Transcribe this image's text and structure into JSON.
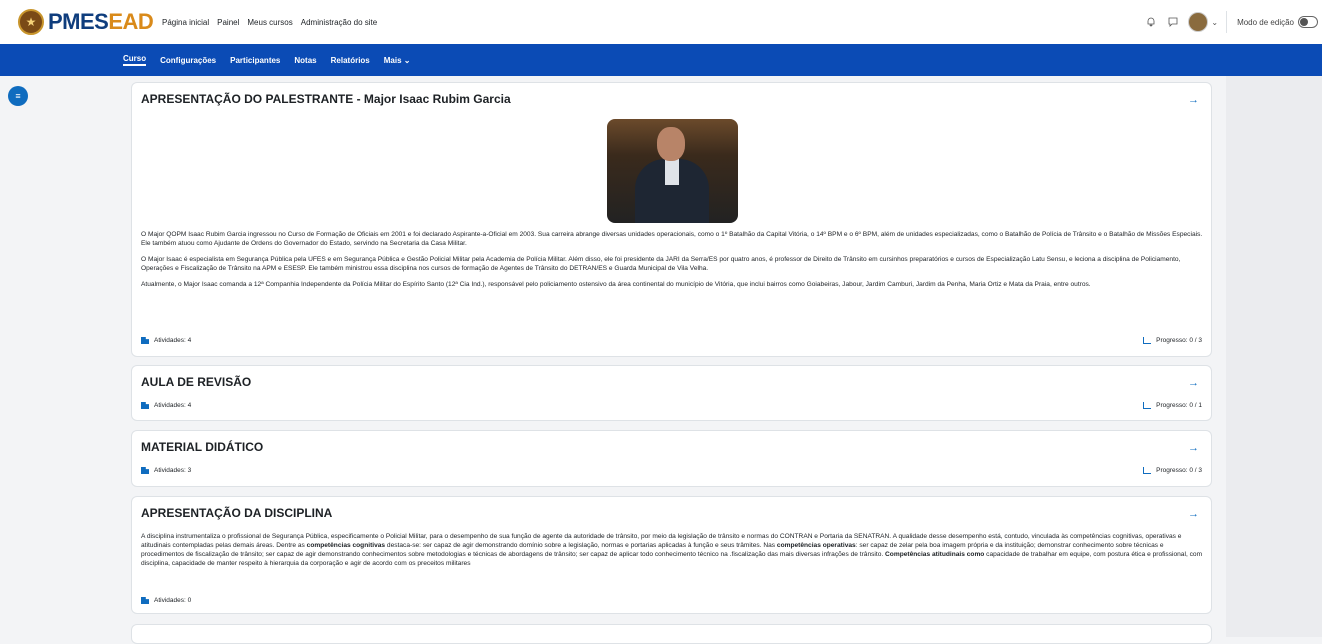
{
  "brand": {
    "logo_text_a": "PMES",
    "logo_text_b": "EAD"
  },
  "primary_nav": [
    "Página inicial",
    "Painel",
    "Meus cursos",
    "Administração do site"
  ],
  "user_menu": {
    "edit_mode_label": "Modo de edição"
  },
  "course_nav": {
    "items": [
      "Curso",
      "Configurações",
      "Participantes",
      "Notas",
      "Relatórios",
      "Mais ⌄"
    ],
    "active": "Curso"
  },
  "sections": [
    {
      "title": "APRESENTAÇÃO DO PALESTRANTE - Major Isaac Rubim Garcia",
      "paragraphs": [
        "O Major QOPM Isaac Rubim Garcia ingressou no Curso de Formação de Oficiais em 2001 e foi declarado Aspirante-a-Oficial em 2003. Sua carreira abrange diversas unidades operacionais, como o 1º Batalhão da Capital Vitória, o 14º BPM e o 6º BPM, além de unidades especializadas, como o Batalhão de Polícia de Trânsito e o Batalhão de Missões Especiais. Ele também atuou como Ajudante de Ordens do Governador do Estado, servindo na Secretaria da Casa Militar.",
        "O Major Isaac é especialista em Segurança Pública pela UFES e em Segurança Pública e Gestão Policial Militar pela Academia de Polícia Militar. Além disso, ele foi presidente da JARI da Serra/ES por quatro anos, é professor de Direito de Trânsito em cursinhos preparatórios e cursos de Especialização Latu Sensu, e leciona a disciplina de Policiamento, Operações e Fiscalização de Trânsito na APM e ESESP. Ele também ministrou essa disciplina nos cursos de formação de Agentes de Trânsito do DETRAN/ES e Guarda Municipal de Vila Velha.",
        "Atualmente, o Major Isaac comanda a 12ª Companhia Independente da Polícia Militar do Espírito Santo (12ª Cia Ind.), responsável pelo policiamento ostensivo da área continental do município de Vitória, que inclui bairros como Goiabeiras, Jabour, Jardim Camburi, Jardim da Penha, Maria Ortiz e Mata da Praia, entre outros."
      ],
      "activities": "Atividades: 4",
      "progress": "Progresso: 0 / 3"
    },
    {
      "title": "AULA DE REVISÃO",
      "activities": "Atividades: 4",
      "progress": "Progresso: 0 / 1"
    },
    {
      "title": "MATERIAL DIDÁTICO",
      "activities": "Atividades: 3",
      "progress": "Progresso: 0 / 3"
    },
    {
      "title": "APRESENTAÇÃO DA DISCIPLINA",
      "paragraph": [
        {
          "t": "A disciplina instrumentaliza o profissional de Segurança Pública, especificamente o Policial Militar, para o desempenho de sua função de agente da autoridade de trânsito, por meio da legislação de trânsito e normas do CONTRAN e Portaria da SENATRAN.  A qualidade desse desempenho está, contudo, vinculada às competências cognitivas, operativas e atitudinais contempladas pelas demais áreas. Dentre as ",
          "b": false
        },
        {
          "t": "competências cognitivas",
          "b": true
        },
        {
          "t": " destaca-se: ser capaz de agir demonstrando domínio sobre a legislação, normas e portarias aplicadas à função e seus trâmites. Nas ",
          "b": false
        },
        {
          "t": "competências operativas",
          "b": true
        },
        {
          "t": ": ser capaz de zelar pela boa imagem própria e da instituição; demonstrar conhecimento sobre técnicas e procedimentos de fiscalização de trânsito; ser capaz de agir demonstrando conhecimentos sobre metodologias e técnicas de abordagens de trânsito; ser capaz de aplicar todo conhecimento técnico na .fiscalização das mais diversas infrações de trânsito. ",
          "b": false
        },
        {
          "t": "Competências atitudinais como",
          "b": true
        },
        {
          "t": " capacidade de trabalhar em equipe, com postura ética e profissional, com disciplina, capacidade de manter respeito à hierarquia da corporação e agir de acordo com os preceitos militares",
          "b": false
        }
      ],
      "activities": "Atividades: 0"
    }
  ]
}
